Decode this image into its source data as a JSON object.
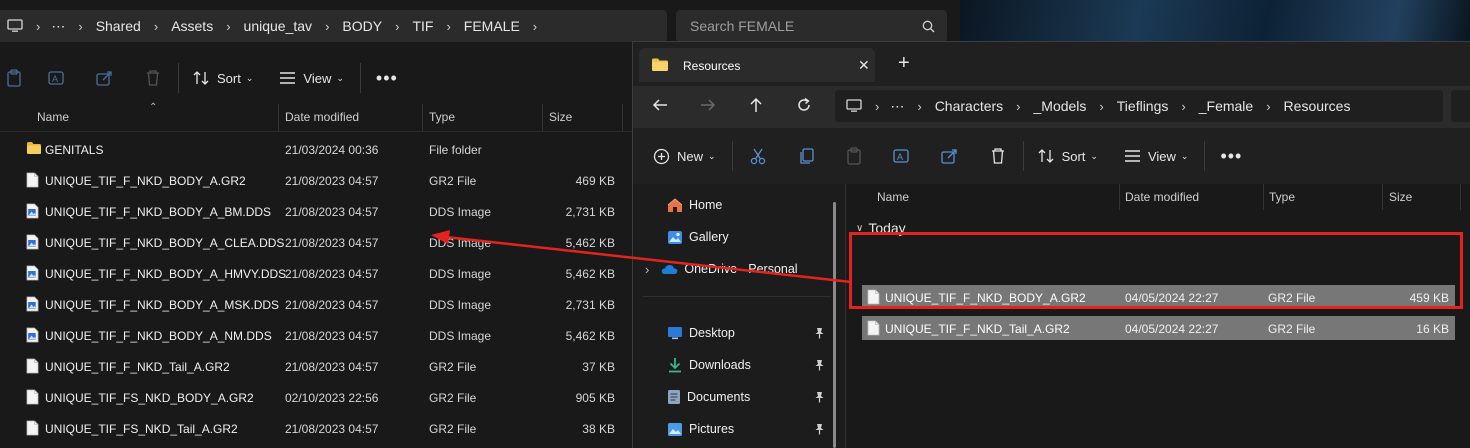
{
  "left_window": {
    "breadcrumb": [
      "Shared",
      "Assets",
      "unique_tav",
      "BODY",
      "TIF",
      "FEMALE"
    ],
    "search_placeholder": "Search FEMALE",
    "toolbar": {
      "sort_label": "Sort",
      "view_label": "View"
    },
    "columns": {
      "name": "Name",
      "date": "Date modified",
      "type": "Type",
      "size": "Size"
    },
    "files": [
      {
        "name": "GENITALS",
        "date": "21/03/2024 00:36",
        "type": "File folder",
        "size": "",
        "icon": "folder-icon"
      },
      {
        "name": "UNIQUE_TIF_F_NKD_BODY_A.GR2",
        "date": "21/08/2023 04:57",
        "type": "GR2 File",
        "size": "469 KB",
        "icon": "file-icon"
      },
      {
        "name": "UNIQUE_TIF_F_NKD_BODY_A_BM.DDS",
        "date": "21/08/2023 04:57",
        "type": "DDS Image",
        "size": "2,731 KB",
        "icon": "image-file-icon"
      },
      {
        "name": "UNIQUE_TIF_F_NKD_BODY_A_CLEA.DDS",
        "date": "21/08/2023 04:57",
        "type": "DDS Image",
        "size": "5,462 KB",
        "icon": "image-file-icon"
      },
      {
        "name": "UNIQUE_TIF_F_NKD_BODY_A_HMVY.DDS",
        "date": "21/08/2023 04:57",
        "type": "DDS Image",
        "size": "5,462 KB",
        "icon": "image-file-icon"
      },
      {
        "name": "UNIQUE_TIF_F_NKD_BODY_A_MSK.DDS",
        "date": "21/08/2023 04:57",
        "type": "DDS Image",
        "size": "2,731 KB",
        "icon": "image-file-icon"
      },
      {
        "name": "UNIQUE_TIF_F_NKD_BODY_A_NM.DDS",
        "date": "21/08/2023 04:57",
        "type": "DDS Image",
        "size": "5,462 KB",
        "icon": "image-file-icon"
      },
      {
        "name": "UNIQUE_TIF_F_NKD_Tail_A.GR2",
        "date": "21/08/2023 04:57",
        "type": "GR2 File",
        "size": "37 KB",
        "icon": "file-icon"
      },
      {
        "name": "UNIQUE_TIF_FS_NKD_BODY_A.GR2",
        "date": "02/10/2023 22:56",
        "type": "GR2 File",
        "size": "905 KB",
        "icon": "file-icon"
      },
      {
        "name": "UNIQUE_TIF_FS_NKD_Tail_A.GR2",
        "date": "21/08/2023 04:57",
        "type": "GR2 File",
        "size": "38 KB",
        "icon": "file-icon"
      }
    ]
  },
  "right_window": {
    "tab_title": "Resources",
    "breadcrumb": [
      "Characters",
      "_Models",
      "Tieflings",
      "_Female",
      "Resources"
    ],
    "toolbar": {
      "new_label": "New",
      "sort_label": "Sort",
      "view_label": "View"
    },
    "sidebar": [
      {
        "label": "Home",
        "icon": "home-icon"
      },
      {
        "label": "Gallery",
        "icon": "gallery-icon"
      },
      {
        "label": "OneDrive - Personal",
        "icon": "onedrive-icon"
      },
      {
        "label": "Desktop",
        "icon": "desktop-folder-icon"
      },
      {
        "label": "Downloads",
        "icon": "downloads-icon"
      },
      {
        "label": "Documents",
        "icon": "documents-icon"
      },
      {
        "label": "Pictures",
        "icon": "pictures-icon"
      }
    ],
    "columns": {
      "name": "Name",
      "date": "Date modified",
      "type": "Type",
      "size": "Size"
    },
    "group_label": "Today",
    "files": [
      {
        "name": "UNIQUE_TIF_F_NKD_BODY_A.GR2",
        "date": "04/05/2024 22:27",
        "type": "GR2 File",
        "size": "459 KB"
      },
      {
        "name": "UNIQUE_TIF_F_NKD_Tail_A.GR2",
        "date": "04/05/2024 22:27",
        "type": "GR2 File",
        "size": "16 KB"
      }
    ]
  },
  "colors": {
    "annotation_red": "#e3241e",
    "selection_gray": "#777777",
    "folder_yellow": "#f0c24b",
    "dds_icon_blue": "#2f6fd6"
  }
}
